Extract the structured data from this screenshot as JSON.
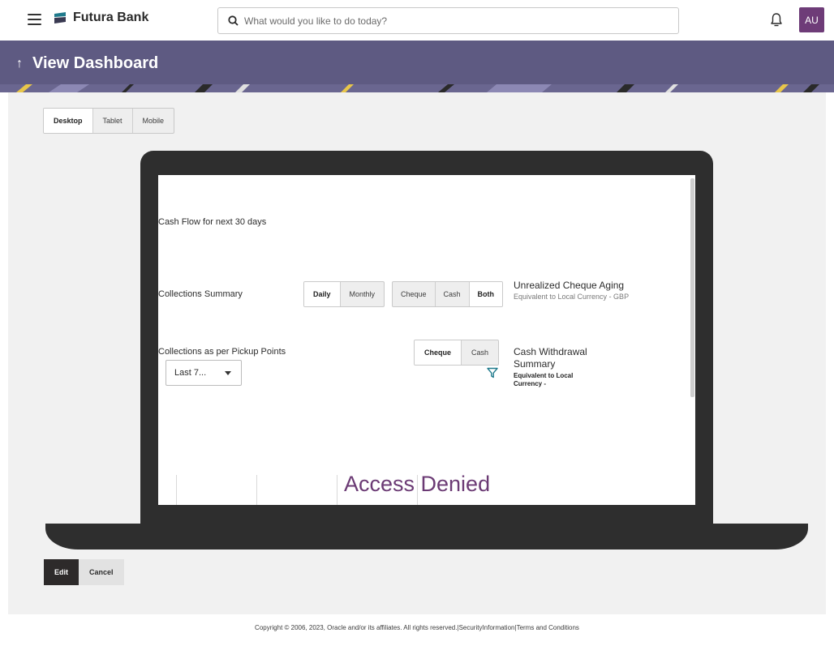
{
  "topbar": {
    "brand_name": "Futura Bank",
    "search_placeholder": "What would you like to do today?",
    "avatar_initials": "AU"
  },
  "header": {
    "title": "View Dashboard"
  },
  "view_modes": [
    "Desktop",
    "Tablet",
    "Mobile"
  ],
  "active_view_mode": "Desktop",
  "widgets": {
    "cash_flow": {
      "title": "Cash Flow for next 30 days"
    },
    "collections_summary": {
      "title": "Collections Summary",
      "period_options": [
        "Daily",
        "Monthly"
      ],
      "active_period": "Daily",
      "type_options": [
        "Cheque",
        "Cash",
        "Both"
      ],
      "active_type": "Both"
    },
    "unrealized_cheque": {
      "title": "Unrealized Cheque Aging",
      "subtitle": "Equivalent to Local Currency - GBP"
    },
    "pickup_points": {
      "title": "Collections as per Pickup Points",
      "dropdown_value": "Last 7...",
      "type_options": [
        "Cheque",
        "Cash"
      ],
      "active_type": "Cheque"
    },
    "cash_withdrawal": {
      "title_line1": "Cash Withdrawal",
      "title_line2": "Summary",
      "note_line1": "Equivalent to Local",
      "note_line2": "Currency -"
    },
    "access_denied": "Access Denied"
  },
  "actions": {
    "edit_label": "Edit",
    "cancel_label": "Cancel"
  },
  "footer": {
    "copyright": "Copyright © 2006, 2023, Oracle and/or its affiliates. All rights reserved.|",
    "security_link": "SecurityInformation",
    "separator": "|",
    "terms_link": "Terms and Conditions"
  },
  "colors": {
    "header_band": "#5e5a82",
    "avatar": "#6e3c78",
    "access_denied": "#6b3a74",
    "filter_icon": "#1f7a8c",
    "laptop": "#2e2e2e"
  }
}
